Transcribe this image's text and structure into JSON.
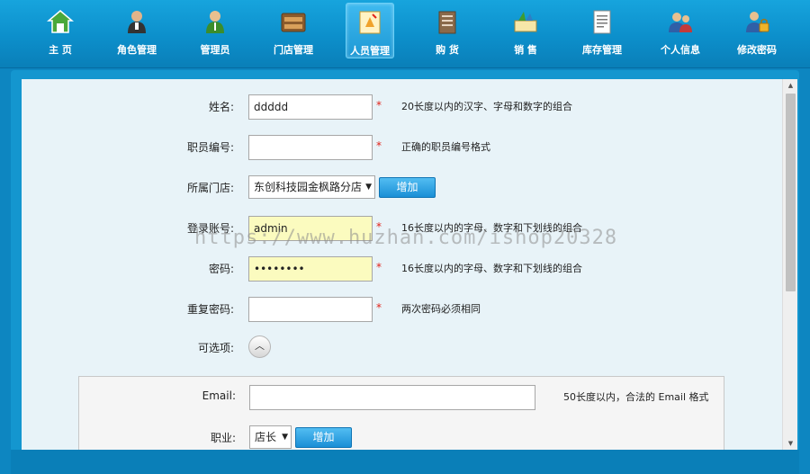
{
  "nav": {
    "items": [
      {
        "label": "主  页",
        "icon": "home-icon"
      },
      {
        "label": "角色管理",
        "icon": "role-icon"
      },
      {
        "label": "管理员",
        "icon": "admin-icon"
      },
      {
        "label": "门店管理",
        "icon": "store-icon"
      },
      {
        "label": "人员管理",
        "icon": "staff-icon"
      },
      {
        "label": "购  货",
        "icon": "purchase-icon"
      },
      {
        "label": "销  售",
        "icon": "sales-icon"
      },
      {
        "label": "库存管理",
        "icon": "inventory-icon"
      },
      {
        "label": "个人信息",
        "icon": "profile-icon"
      },
      {
        "label": "修改密码",
        "icon": "password-icon"
      }
    ],
    "active_index": 4,
    "active_color": "#2aa8e3"
  },
  "form": {
    "name": {
      "label": "姓名:",
      "value": "ddddd",
      "required": "*",
      "hint": "20长度以内的汉字、字母和数字的组合"
    },
    "staff_no": {
      "label": "职员编号:",
      "value": "",
      "required": "*",
      "hint": "正确的职员编号格式"
    },
    "store": {
      "label": "所属门店:",
      "selected": "东创科技园金枫路分店",
      "add_label": "增加"
    },
    "login": {
      "label": "登录账号:",
      "value": "admin",
      "required": "*",
      "hint": "16长度以内的字母、数字和下划线的组合"
    },
    "password": {
      "label": "密码:",
      "value": "••••••••",
      "required": "*",
      "hint": "16长度以内的字母、数字和下划线的组合"
    },
    "repeat_password": {
      "label": "重复密码:",
      "value": "",
      "required": "*",
      "hint": "两次密码必须相同"
    },
    "optional": {
      "label": "可选项:"
    },
    "email": {
      "label": "Email:",
      "value": "",
      "hint": "50长度以内，合法的 Email 格式"
    },
    "position": {
      "label": "职业:",
      "selected": "店长",
      "add_label": "增加"
    }
  },
  "watermark": "https://www.huzhan.com/ishop20328",
  "colors": {
    "nav_bg": "#0c8fcb",
    "content_bg": "#e8f3f8",
    "required": "#e2231a",
    "button": "#1a8fd6"
  }
}
